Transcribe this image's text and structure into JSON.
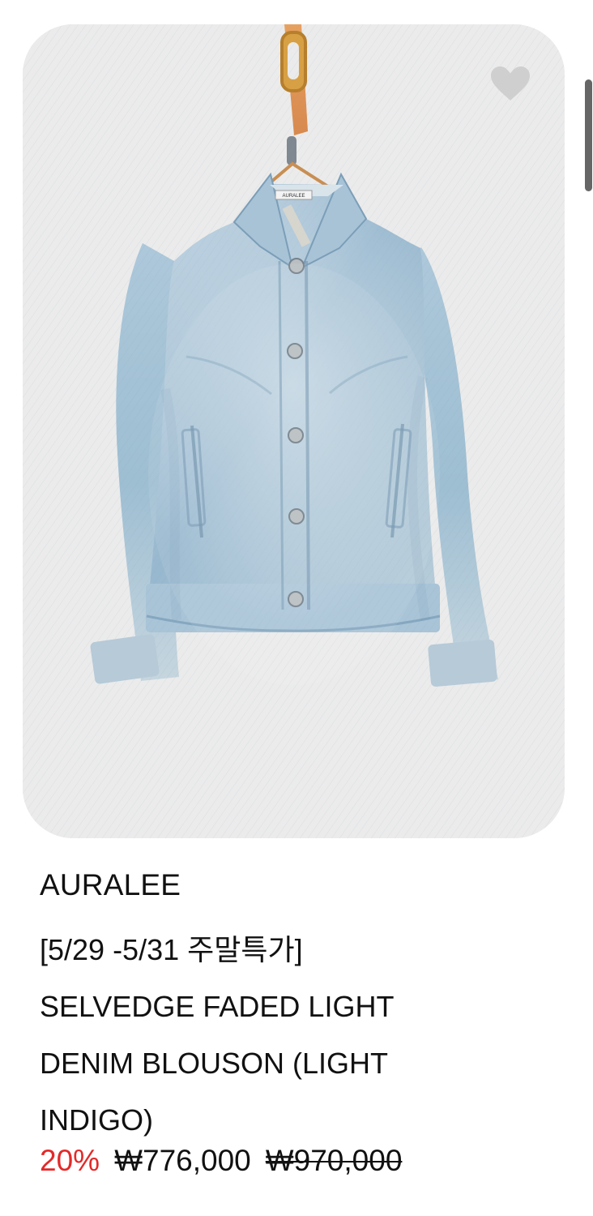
{
  "product": {
    "brand": "AURALEE",
    "name_lines": [
      "[5/29 -5/31 주말특가]",
      "SELVEDGE FADED LIGHT",
      "DENIM BLOUSON (LIGHT",
      "INDIGO)"
    ],
    "image_alt": "denim jacket",
    "label_text": "AURALEE",
    "wishlisted": false,
    "discount": "20%",
    "sale_price": "₩776,000",
    "original_price": "₩970,000"
  },
  "colors": {
    "background": "#ffffff",
    "image_background": "#ebebeb",
    "discount": "#e32929",
    "text": "#111111",
    "denim": "#9bbad1",
    "wishlist_icon": "#cfcfcf"
  },
  "icons": {
    "wishlist": "heart-icon"
  }
}
